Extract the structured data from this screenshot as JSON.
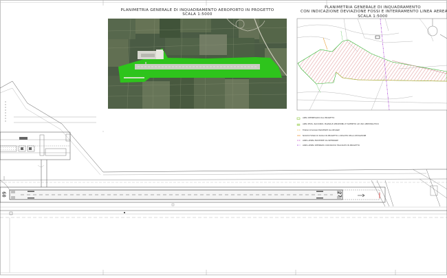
{
  "titles": {
    "left": {
      "line1": "PLANIMETRIA GENERALE DI INQUADRAMENTO AEROPORTO IN PROGETTO",
      "line2": "SCALA 1:5000"
    },
    "right": {
      "line1": "PLANIMETRIA GENERALE DI INQUADRAMENTO",
      "line2": "CON INDICAZIONE DEVIAZIONE FOSSI E INTERRAMENTO LINEA AEREA",
      "line3": "SCALA 1:5000"
    }
  },
  "runway": {
    "designator_west": "09",
    "designator_east": "27"
  },
  "legend": [
    {
      "text": "AREA INTERESSATA DAL PROGETTO",
      "color": "#8cc63f"
    },
    {
      "text": "AREA PISTA, RACCORDI, PIAZZALE AEROMOBILI E SUPERFICI AD USO AEREONAUTICO",
      "color": "#c8e6a0"
    },
    {
      "text": "FOSSO DI SCOLO ESISTENTE DA DEVIARE",
      "color": "#e9b44c"
    },
    {
      "text": "NUOVO FOSSO DI SCOLO IN PROGETTO A SEGUITO DELLA DEVIAZIONE",
      "color": "#e98b2a"
    },
    {
      "text": "LINEA AEREA ESISTENTE DA INTERRARE",
      "color": "#c040c0"
    },
    {
      "text": "LINEA AEREA INTERRATA CON NUOVO TRACCIATO IN PROGETTO",
      "color": "#9b3bd6"
    }
  ],
  "colors": {
    "project_green": "#2ec41c",
    "satellite_base": "#4a5b44",
    "hatch": "#e3a3a3",
    "fence_green": "#2fb52f",
    "fence_orange": "#e8a23a",
    "powerline": "#b14fd8"
  }
}
